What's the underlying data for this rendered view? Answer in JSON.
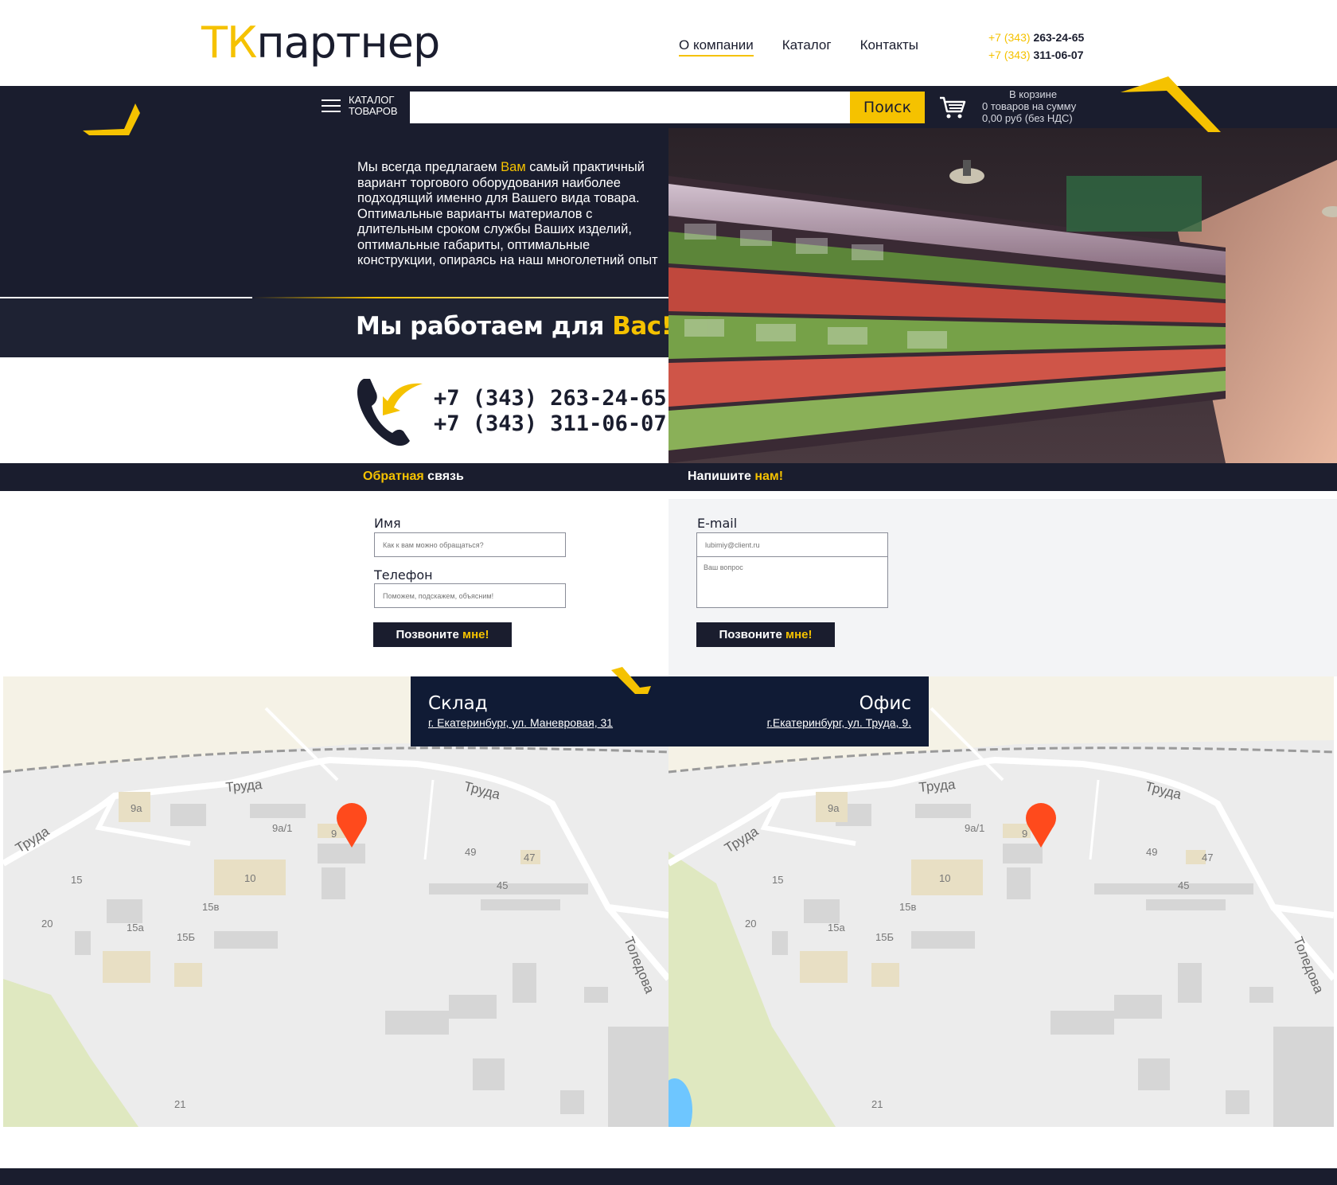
{
  "header": {
    "logo_tk": "ТК",
    "logo_rest": "партнер",
    "nav": [
      {
        "label": "О компании"
      },
      {
        "label": "Каталог"
      },
      {
        "label": "Контакты"
      }
    ],
    "phones": [
      {
        "code": "+7 (343)",
        "number": "263-24-65"
      },
      {
        "code": "+7 (343)",
        "number": "311-06-07"
      }
    ]
  },
  "searchbar": {
    "catalog_line1": "КАТАЛОГ",
    "catalog_line2": "ТОВАРОВ",
    "search_value": "",
    "search_button": "Поиск",
    "cart_title": "В корзине",
    "cart_count": "0 товаров на сумму",
    "cart_sum": "0,00 руб (без НДС)"
  },
  "hero": {
    "text_before": "Мы всегда предлагаем ",
    "text_highlight": "Вам",
    "text_after": " самый практичный вариант  торгового оборудования наиболее подходящий именно для Вашего вида товара. Оптимальные варианты материалов с длительным сроком службы Ваших изделий, оптимальные габариты, оптимальные конструкции, опираясь на наш многолетний опыт",
    "slogan_main": "Мы работаем для ",
    "slogan_highlight": "Вас!",
    "phone1": "+7 (343) 263-24-65",
    "phone2": "+7 (343) 311-06-07"
  },
  "feedback": {
    "left_title_hl": "Обратная",
    "left_title_rest": " связь",
    "right_title_rest": "Напишите ",
    "right_title_hl": "нам!",
    "name_label": "Имя",
    "name_placeholder": "Как к вам можно обращаться?",
    "phone_label": "Телефон",
    "phone_placeholder": "Поможем, подскажем, объясним!",
    "email_label": "E-mail",
    "email_placeholder": "lubimiy@client.ru",
    "question_placeholder": "Ваш вопрос",
    "button_main": "Позвоните ",
    "button_hl": "мне!"
  },
  "maps": {
    "warehouse_title": "Склад",
    "warehouse_address": "г. Екатеринбург, ул. Маневровая, 31",
    "office_title": "Офис",
    "office_address": "г.Екатеринбург, ул. Труда, 9.",
    "street_labels": [
      "Труда",
      "Труда",
      "Труда",
      "Толедова"
    ],
    "house_labels": [
      "9а",
      "9а/1",
      "9",
      "49",
      "47",
      "45",
      "10",
      "15",
      "15в",
      "20",
      "15а",
      "15Б",
      "21"
    ]
  },
  "colors": {
    "accent": "#f5c200",
    "dark": "#1a1d2e",
    "map_label_bg": "#101b35",
    "pin": "#ff4a1c"
  }
}
